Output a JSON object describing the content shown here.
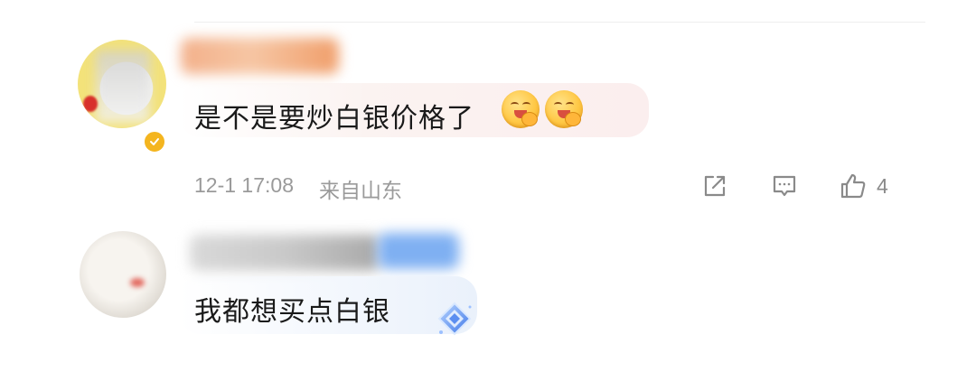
{
  "comments": [
    {
      "text": "是不是要炒白银价格了",
      "emojis": [
        "yummy-face-emoji",
        "yummy-face-emoji"
      ],
      "time": "12-1 17:08",
      "location": "来自山东",
      "like_count": "4",
      "badge": "verified-badge",
      "highlight_color": "#fbeeee"
    },
    {
      "text": "我都想买点白银",
      "badge": "diamond-icon",
      "highlight_color": "#eaf1fb"
    }
  ],
  "icons": {
    "share": "share-icon",
    "comment": "comment-icon",
    "like": "thumbs-up-icon"
  },
  "colors": {
    "meta_text": "#9a9a9a",
    "verified_badge": "#f4b51f",
    "diamond": "#5b8ef0"
  }
}
